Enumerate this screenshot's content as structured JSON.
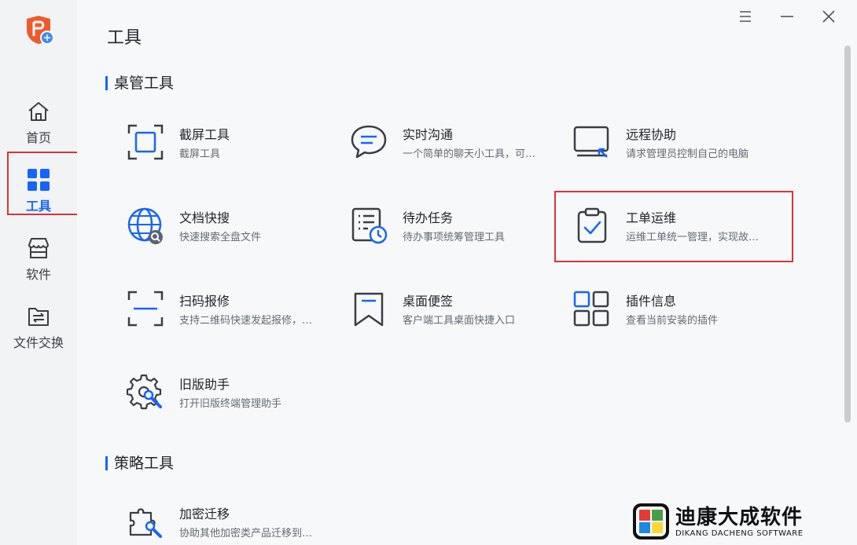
{
  "sidebar": {
    "items": [
      {
        "label": "首页",
        "icon": "home-icon"
      },
      {
        "label": "工具",
        "icon": "grid-icon",
        "active": true
      },
      {
        "label": "软件",
        "icon": "store-icon"
      },
      {
        "label": "文件交换",
        "icon": "file-exchange-icon"
      }
    ]
  },
  "header": {
    "title": "工具",
    "controls": [
      "menu-icon",
      "minimize-icon",
      "close-icon"
    ]
  },
  "sections": [
    {
      "title": "桌管工具",
      "tools": [
        {
          "name": "截屏工具",
          "desc": "截屏工具",
          "icon": "screenshot-icon"
        },
        {
          "name": "实时沟通",
          "desc": "一个简单的聊天小工具，可…",
          "icon": "chat-icon"
        },
        {
          "name": "远程协助",
          "desc": "请求管理员控制自己的电脑",
          "icon": "remote-assist-icon"
        },
        {
          "name": "文档快搜",
          "desc": "快速搜索全盘文件",
          "icon": "globe-search-icon"
        },
        {
          "name": "待办任务",
          "desc": "待办事项统筹管理工具",
          "icon": "todo-clock-icon"
        },
        {
          "name": "工单运维",
          "desc": "运维工单统一管理，实现故…",
          "icon": "clipboard-check-icon"
        },
        {
          "name": "扫码报修",
          "desc": "支持二维码快速发起报修，…",
          "icon": "scan-icon"
        },
        {
          "name": "桌面便签",
          "desc": "客户端工具桌面快捷入口",
          "icon": "bookmark-icon"
        },
        {
          "name": "插件信息",
          "desc": "查看当前安装的插件",
          "icon": "plugin-grid-icon"
        },
        {
          "name": "旧版助手",
          "desc": "打开旧版终端管理助手",
          "icon": "gear-wrench-icon"
        }
      ]
    },
    {
      "title": "策略工具",
      "tools": [
        {
          "name": "加密迁移",
          "desc": "协助其他加密类产品迁移到…",
          "icon": "puzzle-wrench-icon"
        }
      ]
    }
  ],
  "watermark": {
    "cn": "迪康大成软件",
    "en": "DIKANG DACHENG SOFTWARE"
  },
  "colors": {
    "accent": "#1664ff",
    "highlight": "#d2363b",
    "logo": "#f05a28"
  }
}
